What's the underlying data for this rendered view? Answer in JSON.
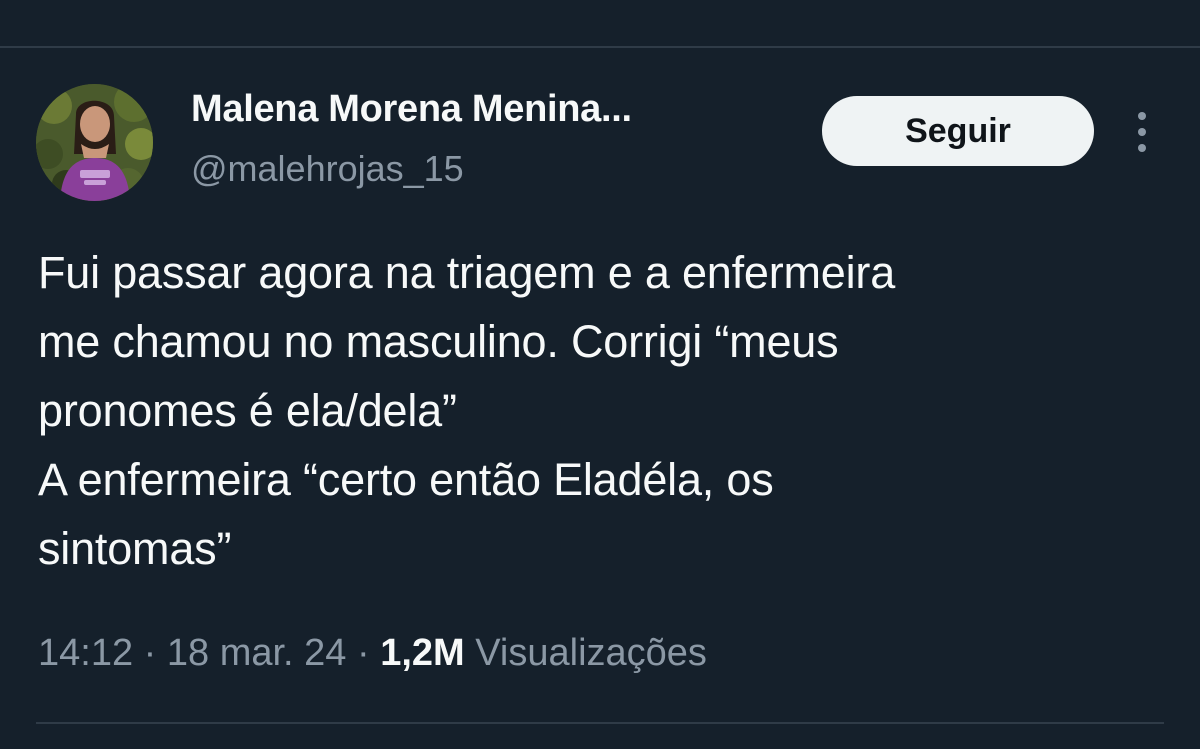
{
  "profile": {
    "display_name": "Malena Morena Menina...",
    "handle": "@malehrojas_15",
    "avatar_icon": "profile-photo"
  },
  "actions": {
    "follow_label": "Seguir",
    "more_icon": "more-vertical-icon"
  },
  "tweet": {
    "lines": [
      "Fui passar agora na triagem e a enfermeira",
      "me chamou no masculino. Corrigi “meus",
      "pronomes é ela/dela”",
      "A enfermeira “certo então Eladéla, os",
      "sintomas”"
    ]
  },
  "meta": {
    "time": "14:12",
    "separator": "·",
    "date": "18 mar. 24",
    "views_count": "1,2M",
    "views_label": "Visualizações"
  },
  "colors": {
    "background": "#15202b",
    "primary_text": "#f7f9f9",
    "secondary_text": "#8b98a5",
    "divider": "#2f3b47",
    "button_bg": "#eff3f4"
  }
}
